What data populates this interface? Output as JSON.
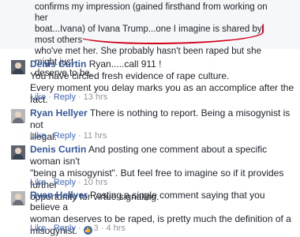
{
  "quoted_post": {
    "line1": "confirms my impression (gained firsthand from working on her",
    "line2": "boat...Ivana) of Ivana Trump...one I imagine is shared by most others",
    "line3": "who've met her. She probably hasn't been raped but she might just",
    "line4": "deserve to be."
  },
  "comments": [
    {
      "author": "Denis Curtin",
      "lines": [
        "Ryan.....call 911 !",
        "You have circled fresh evidence of rape culture.",
        "Every moment you delay marks you as an accomplice after the fact."
      ],
      "like": "Like",
      "reply": "Reply",
      "time": "13 hrs",
      "reactions": ""
    },
    {
      "author": "Ryan Hellyer",
      "lines": [
        "There is nothing to report. Being a misogynist is not",
        "illegal."
      ],
      "like": "Like",
      "reply": "Reply",
      "time": "11 hrs",
      "reactions": ""
    },
    {
      "author": "Denis Curtin",
      "lines": [
        "And posting one comment about a specific woman isn't",
        "\"being a misogynist\". But feel free to imagine so if it provides further",
        "opportunity for virtue signaling."
      ],
      "like": "Like",
      "reply": "Reply",
      "time": "10 hrs",
      "reactions": ""
    },
    {
      "author": "Ryan Hellyer",
      "lines": [
        "Posting a single comment saying that you believe a",
        "woman deserves to be raped, is pretty much the definition of a",
        "misogynist."
      ],
      "like": "Like",
      "reply": "Reply",
      "time": "4 hrs",
      "reactions": "3"
    }
  ],
  "colors": {
    "author": "#365899",
    "link": "#4267b2",
    "meta": "#90949c",
    "annotation": "#d0021b"
  },
  "icons": {
    "reaction": "like-thumb-icon"
  }
}
